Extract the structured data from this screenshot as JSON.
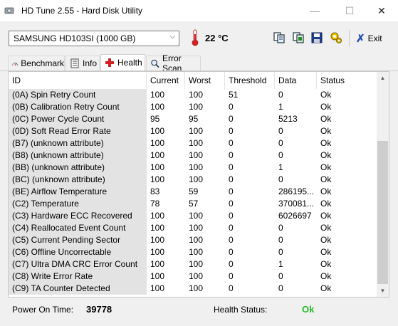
{
  "window": {
    "title": "HD Tune 2.55 - Hard Disk Utility",
    "min": "—",
    "max": "☐",
    "close": "✕"
  },
  "toolbar": {
    "drive": "SAMSUNG HD103SI (1000 GB)",
    "temperature": "22 °C",
    "exit_label": "Exit",
    "icons": [
      "copy-icon",
      "copy-info-icon",
      "save-icon",
      "options-icon"
    ]
  },
  "tabs": [
    {
      "label": "Benchmark",
      "icon": "benchmark-icon"
    },
    {
      "label": "Info",
      "icon": "info-icon"
    },
    {
      "label": "Health",
      "icon": "health-icon",
      "active": true
    },
    {
      "label": "Error Scan",
      "icon": "error-scan-icon"
    }
  ],
  "table": {
    "columns": [
      "ID",
      "Current",
      "Worst",
      "Threshold",
      "Data",
      "Status"
    ],
    "rows": [
      [
        "(0A) Spin Retry Count",
        "100",
        "100",
        "51",
        "0",
        "Ok"
      ],
      [
        "(0B) Calibration Retry Count",
        "100",
        "100",
        "0",
        "1",
        "Ok"
      ],
      [
        "(0C) Power Cycle Count",
        "95",
        "95",
        "0",
        "5213",
        "Ok"
      ],
      [
        "(0D) Soft Read Error Rate",
        "100",
        "100",
        "0",
        "0",
        "Ok"
      ],
      [
        "(B7) (unknown attribute)",
        "100",
        "100",
        "0",
        "0",
        "Ok"
      ],
      [
        "(B8) (unknown attribute)",
        "100",
        "100",
        "0",
        "0",
        "Ok"
      ],
      [
        "(BB) (unknown attribute)",
        "100",
        "100",
        "0",
        "1",
        "Ok"
      ],
      [
        "(BC) (unknown attribute)",
        "100",
        "100",
        "0",
        "0",
        "Ok"
      ],
      [
        "(BE) Airflow Temperature",
        "83",
        "59",
        "0",
        "286195...",
        "Ok"
      ],
      [
        "(C2) Temperature",
        "78",
        "57",
        "0",
        "370081...",
        "Ok"
      ],
      [
        "(C3) Hardware ECC Recovered",
        "100",
        "100",
        "0",
        "6026697",
        "Ok"
      ],
      [
        "(C4) Reallocated Event Count",
        "100",
        "100",
        "0",
        "0",
        "Ok"
      ],
      [
        "(C5) Current Pending Sector",
        "100",
        "100",
        "0",
        "0",
        "Ok"
      ],
      [
        "(C6) Offline Uncorrectable",
        "100",
        "100",
        "0",
        "0",
        "Ok"
      ],
      [
        "(C7) Ultra DMA CRC Error Count",
        "100",
        "100",
        "0",
        "1",
        "Ok"
      ],
      [
        "(C8) Write Error Rate",
        "100",
        "100",
        "0",
        "0",
        "Ok"
      ],
      [
        "(C9) TA Counter Detected",
        "100",
        "100",
        "0",
        "0",
        "Ok"
      ]
    ]
  },
  "footer": {
    "power_on_label": "Power On Time:",
    "power_on_value": "39778",
    "health_label": "Health Status:",
    "health_value": "Ok"
  },
  "colors": {
    "health_ok": "#22b822",
    "id_column_bg": "#e3e3e3"
  }
}
